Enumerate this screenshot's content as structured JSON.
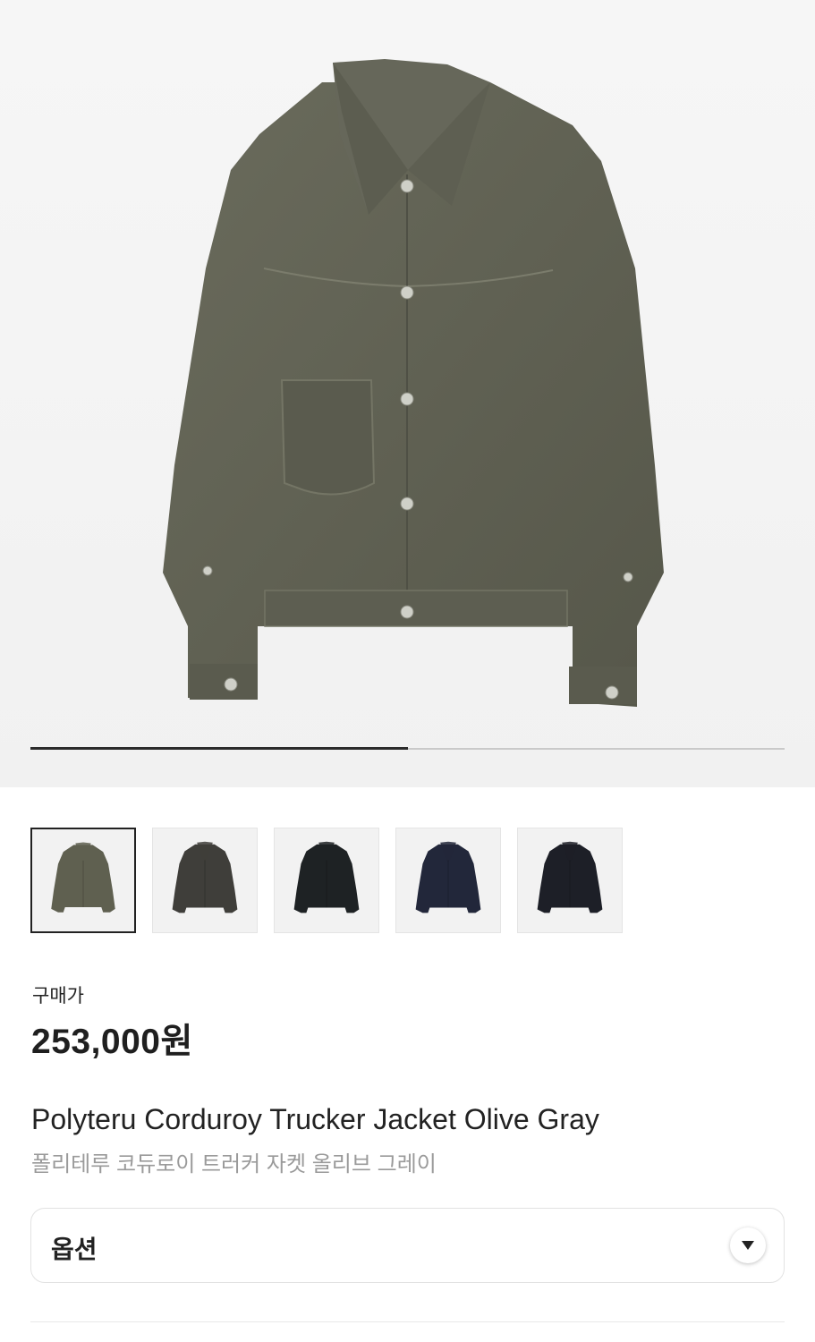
{
  "hero": {
    "image": "olive-gray-corduroy-jacket",
    "slider_progress": 0.5
  },
  "thumbnails": [
    {
      "name": "thumb-olive-gray",
      "color": "#5f6050",
      "selected": true
    },
    {
      "name": "thumb-charcoal",
      "color": "#3f3e3a",
      "selected": false
    },
    {
      "name": "thumb-black-distressed",
      "color": "#1e2224",
      "selected": false
    },
    {
      "name": "thumb-navy",
      "color": "#22273a",
      "selected": false
    },
    {
      "name": "thumb-black",
      "color": "#1d1f27",
      "selected": false
    }
  ],
  "price": {
    "label": "구매가",
    "value": "253,000원"
  },
  "product": {
    "name_en": "Polyteru Corduroy Trucker Jacket Olive Gray",
    "name_ko": "폴리테루 코듀로이 트러커 자켓 올리브 그레이"
  },
  "option": {
    "label": "옵션",
    "icon": "caret-down-icon"
  }
}
